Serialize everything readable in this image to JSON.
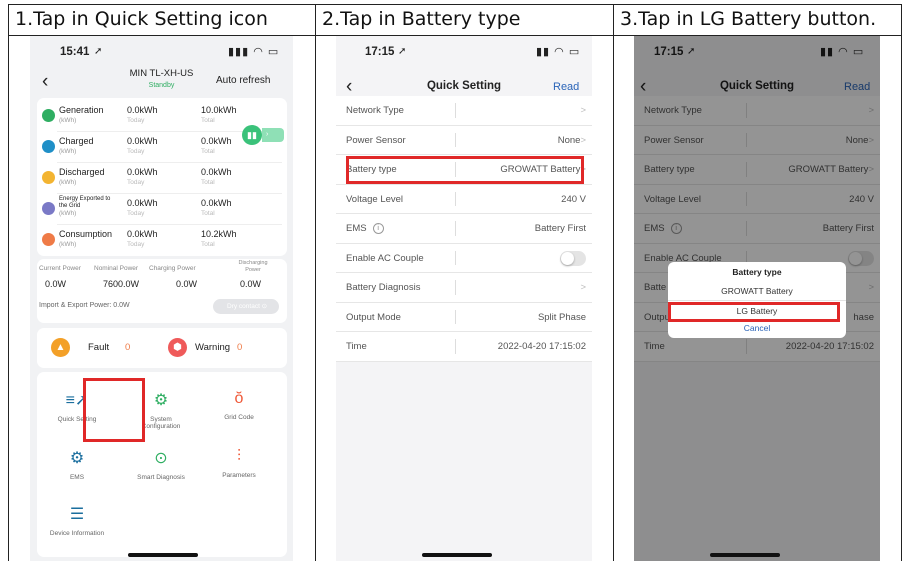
{
  "steps": [
    {
      "label": "1.Tap in Quick Setting icon"
    },
    {
      "label": "2.Tap in Battery type"
    },
    {
      "label": "3.Tap in LG Battery button."
    }
  ],
  "screen1": {
    "time": "15:41",
    "title": "MIN TL-XH-US",
    "status": "Standby",
    "auto_refresh": "Auto refresh",
    "energy_rows": [
      {
        "label": "Generation",
        "unit": "(kWh)",
        "today": "0.0kWh",
        "today_sub": "Today",
        "total": "10.0kWh",
        "total_sub": "Total",
        "color": "#2fae62"
      },
      {
        "label": "Charged",
        "unit": "(kWh)",
        "today": "0.0kWh",
        "today_sub": "Today",
        "total": "0.0kWh",
        "total_sub": "Total",
        "color": "#1f8fc7"
      },
      {
        "label": "Discharged",
        "unit": "(kWh)",
        "today": "0.0kWh",
        "today_sub": "Today",
        "total": "0.0kWh",
        "total_sub": "Total",
        "color": "#f3b431"
      },
      {
        "label": "Energy Exported to the Grid",
        "unit": "(kWh)",
        "today": "0.0kWh",
        "today_sub": "Today",
        "total": "0.0kWh",
        "total_sub": "Total",
        "color": "#7a79c6"
      },
      {
        "label": "Consumption",
        "unit": "(kWh)",
        "today": "0.0kWh",
        "today_sub": "Today",
        "total": "10.2kWh",
        "total_sub": "Total",
        "color": "#ef7b47"
      }
    ],
    "power_headers": [
      "Current Power",
      "Nominal Power",
      "Charging Power",
      "Discharging Power"
    ],
    "power_values": [
      "0.0W",
      "7600.0W",
      "0.0W",
      "0.0W"
    ],
    "import_export": "Import & Export Power: 0.0W",
    "dry_contact": "Dry contact",
    "fault_label": "Fault",
    "fault_count": "0",
    "warning_label": "Warning",
    "warning_count": "0",
    "menu": [
      {
        "label": "Quick Setting",
        "icon": "quick-setting-icon"
      },
      {
        "label": "System Configuration",
        "icon": "system-configuration-icon"
      },
      {
        "label": "Grid Code",
        "icon": "grid-code-icon"
      },
      {
        "label": "EMS",
        "icon": "ems-icon"
      },
      {
        "label": "Smart Diagnosis",
        "icon": "smart-diagnosis-icon"
      },
      {
        "label": "Parameters",
        "icon": "parameters-icon"
      },
      {
        "label": "Device Information",
        "icon": "device-information-icon"
      }
    ]
  },
  "screen2": {
    "time": "17:15",
    "title": "Quick Setting",
    "read": "Read",
    "items": [
      {
        "label": "Network Type",
        "value": ""
      },
      {
        "label": "Power Sensor",
        "value": "None"
      },
      {
        "label": "Battery type",
        "value": "GROWATT Battery"
      },
      {
        "label": "Voltage Level",
        "value": "240 V"
      },
      {
        "label": "EMS",
        "value": "Battery First"
      },
      {
        "label": "Enable AC Couple",
        "value": ""
      },
      {
        "label": "Battery Diagnosis",
        "value": ""
      },
      {
        "label": "Output Mode",
        "value": "Split Phase"
      },
      {
        "label": "Time",
        "value": "2022-04-20 17:15:02"
      }
    ]
  },
  "screen3": {
    "time": "17:15",
    "title": "Quick Setting",
    "read": "Read",
    "items": [
      {
        "label": "Network Type",
        "value": ""
      },
      {
        "label": "Power Sensor",
        "value": "None"
      },
      {
        "label": "Battery type",
        "value": "GROWATT Battery"
      },
      {
        "label": "Voltage Level",
        "value": "240 V"
      },
      {
        "label": "EMS",
        "value": "Battery First"
      },
      {
        "label": "Enable AC Couple",
        "value": ""
      },
      {
        "label": "Batte",
        "value": ""
      },
      {
        "label": "Outpu",
        "value": "hase"
      },
      {
        "label": "Time",
        "value": "2022-04-20 17:15:02"
      }
    ],
    "dialog": {
      "title": "Battery type",
      "options": [
        "GROWATT Battery",
        "LG Battery"
      ],
      "cancel": "Cancel"
    }
  },
  "colors": {
    "highlight": "#e02828",
    "link": "#2a64b8",
    "standby": "#2fae62"
  }
}
